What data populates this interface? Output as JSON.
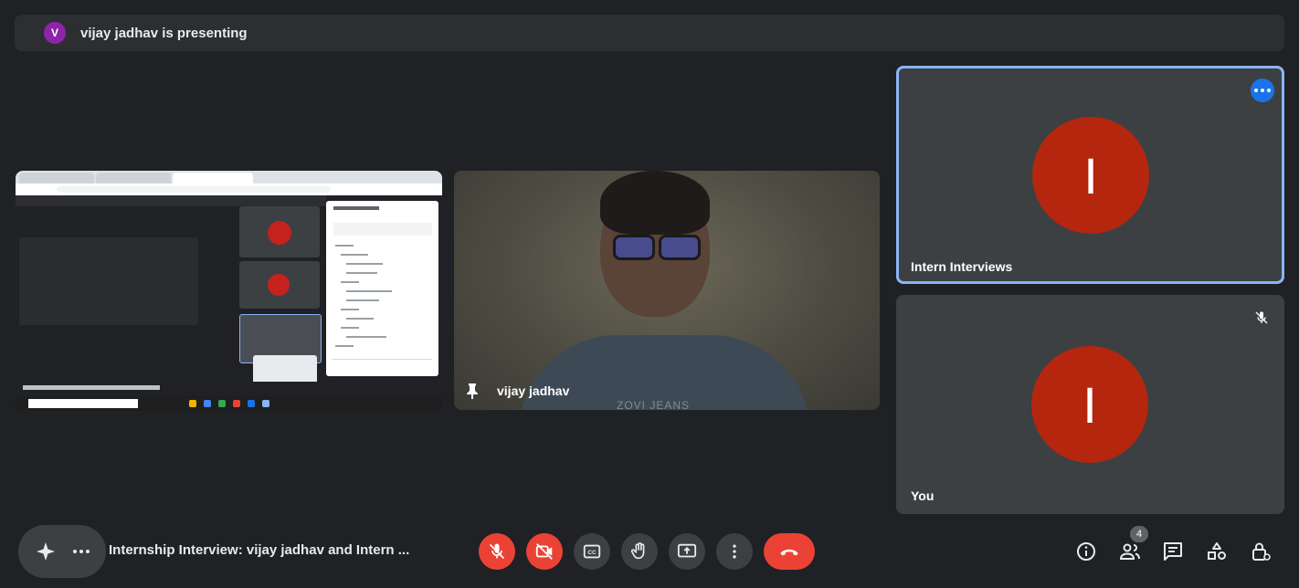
{
  "banner": {
    "avatar_letter": "V",
    "text": "vijay jadhav is presenting"
  },
  "camera": {
    "name": "vijay jadhav",
    "shirt_text": "ZOVI JEANS"
  },
  "participants": [
    {
      "name": "Intern Interviews",
      "avatar_letter": "I",
      "selected": true,
      "has_menu": true
    },
    {
      "name": "You",
      "avatar_letter": "I",
      "muted": true
    }
  ],
  "meeting": {
    "title": "Internship Interview: vijay jadhav and Intern ..."
  },
  "controls": {
    "mic": "mic-off",
    "camera": "camera-off",
    "captions": "closed-captions",
    "raise_hand": "raise-hand",
    "present": "present-screen",
    "more": "more-options",
    "end": "end-call"
  },
  "right_controls": {
    "people_count": "4"
  },
  "colors": {
    "background": "#202124",
    "tile": "#3c4043",
    "avatar": "#b5260e",
    "accent": "#8ab4f8",
    "danger": "#ea4335"
  }
}
